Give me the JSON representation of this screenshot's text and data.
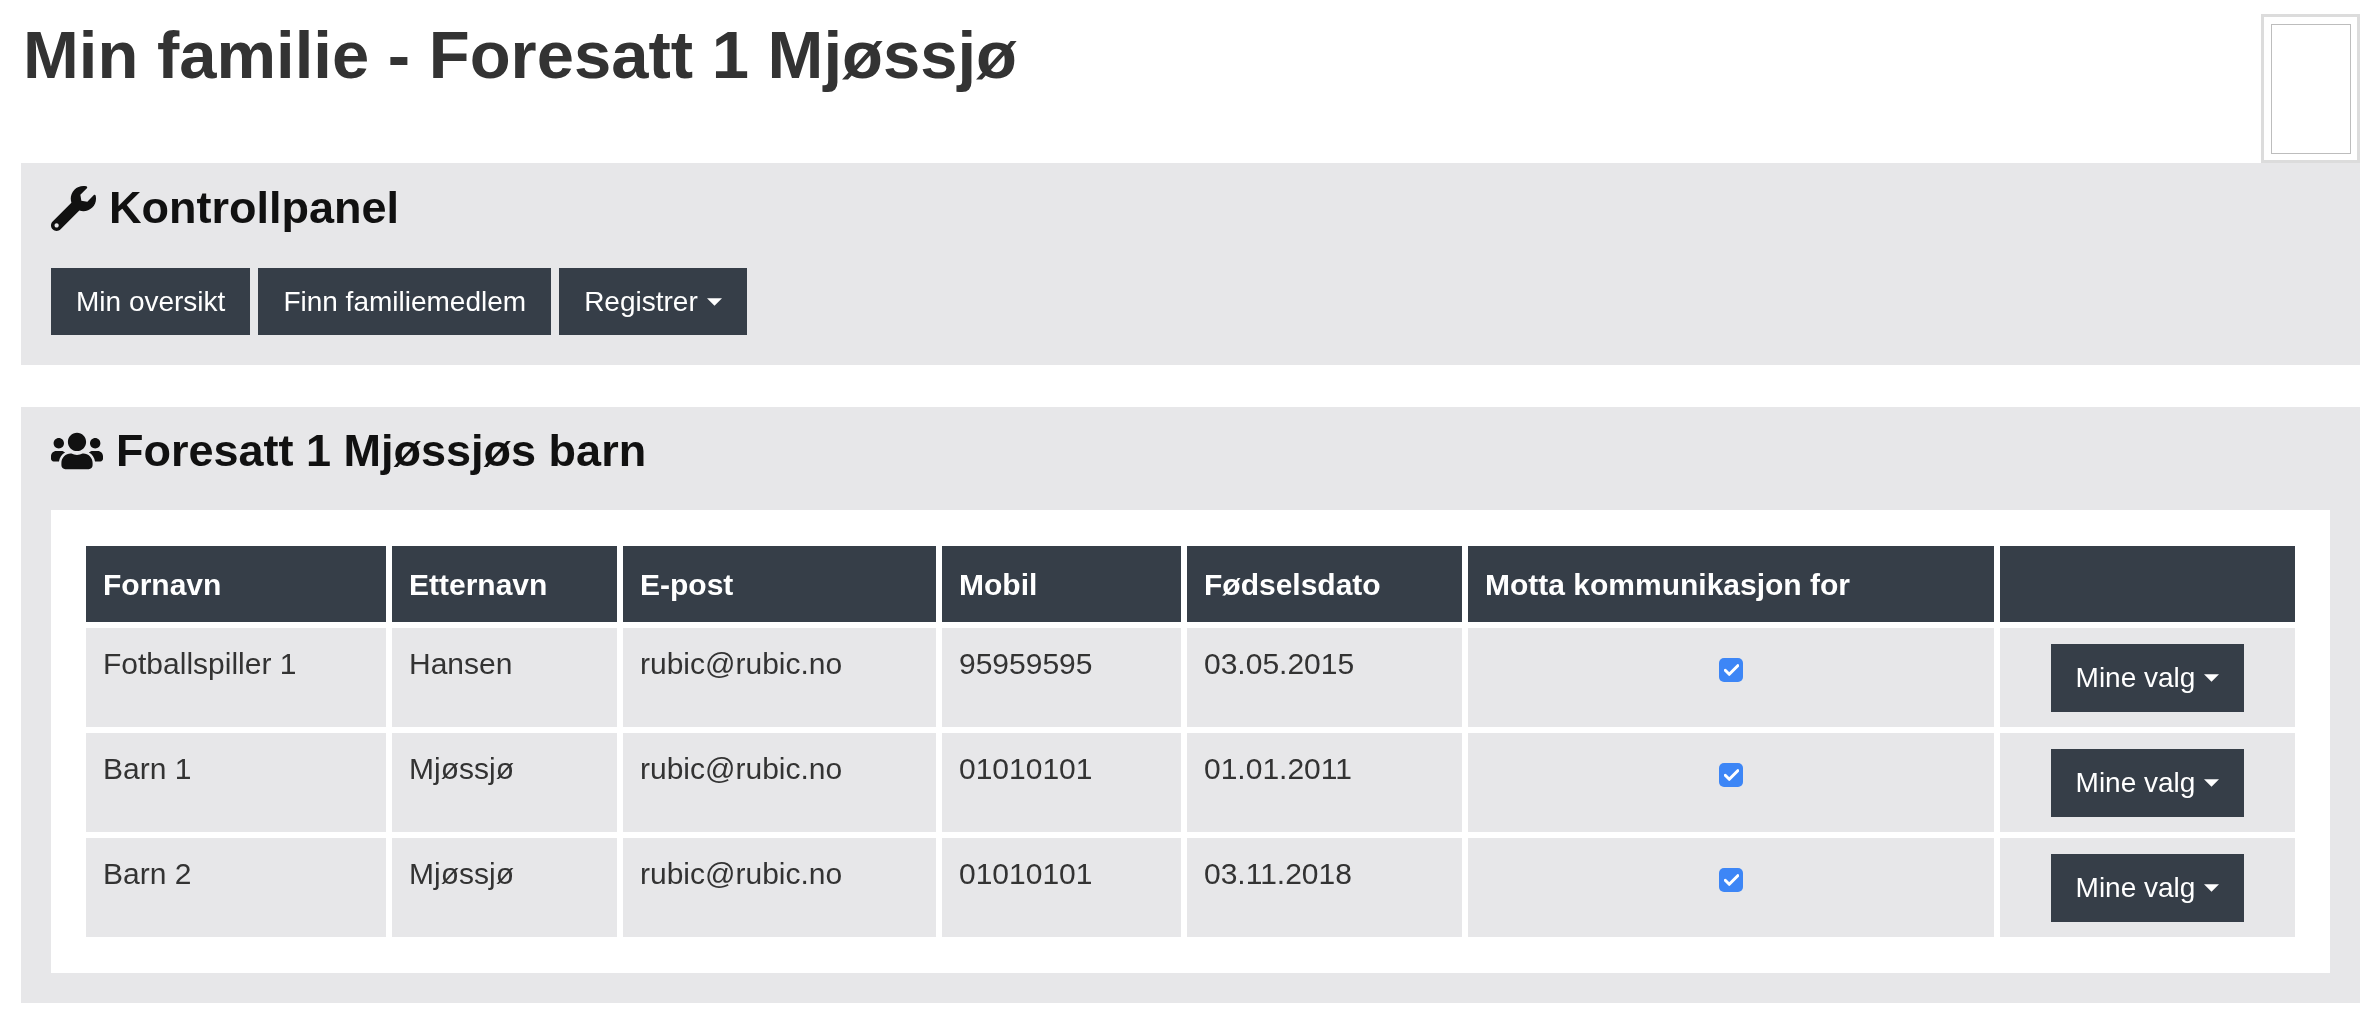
{
  "page": {
    "title": "Min familie - Foresatt 1 Mjøssjø"
  },
  "control_panel": {
    "title": "Kontrollpanel",
    "buttons": [
      {
        "label": "Min oversikt",
        "kind": "button"
      },
      {
        "label": "Finn familiemedlem",
        "kind": "button"
      },
      {
        "label": "Registrer",
        "kind": "dropdown"
      }
    ]
  },
  "children_panel": {
    "title": "Foresatt 1 Mjøssjøs barn",
    "table": {
      "columns": [
        "Fornavn",
        "Etternavn",
        "E-post",
        "Mobil",
        "Fødselsdato",
        "Motta kommunikasjon for"
      ],
      "rows": [
        {
          "first_name": "Fotballspiller 1",
          "last_name": "Hansen",
          "email": "rubic@rubic.no",
          "mobile": "95959595",
          "birth_date": "03.05.2015",
          "receive_communication": true,
          "action": {
            "label": "Mine valg",
            "kind": "dropdown"
          }
        },
        {
          "first_name": "Barn 1",
          "last_name": "Mjøssjø",
          "email": "rubic@rubic.no",
          "mobile": "01010101",
          "birth_date": "01.01.2011",
          "receive_communication": true,
          "action": {
            "label": "Mine valg",
            "kind": "dropdown"
          }
        },
        {
          "first_name": "Barn 2",
          "last_name": "Mjøssjø",
          "email": "rubic@rubic.no",
          "mobile": "01010101",
          "birth_date": "03.11.2018",
          "receive_communication": true,
          "action": {
            "label": "Mine valg",
            "kind": "dropdown"
          }
        }
      ]
    }
  }
}
